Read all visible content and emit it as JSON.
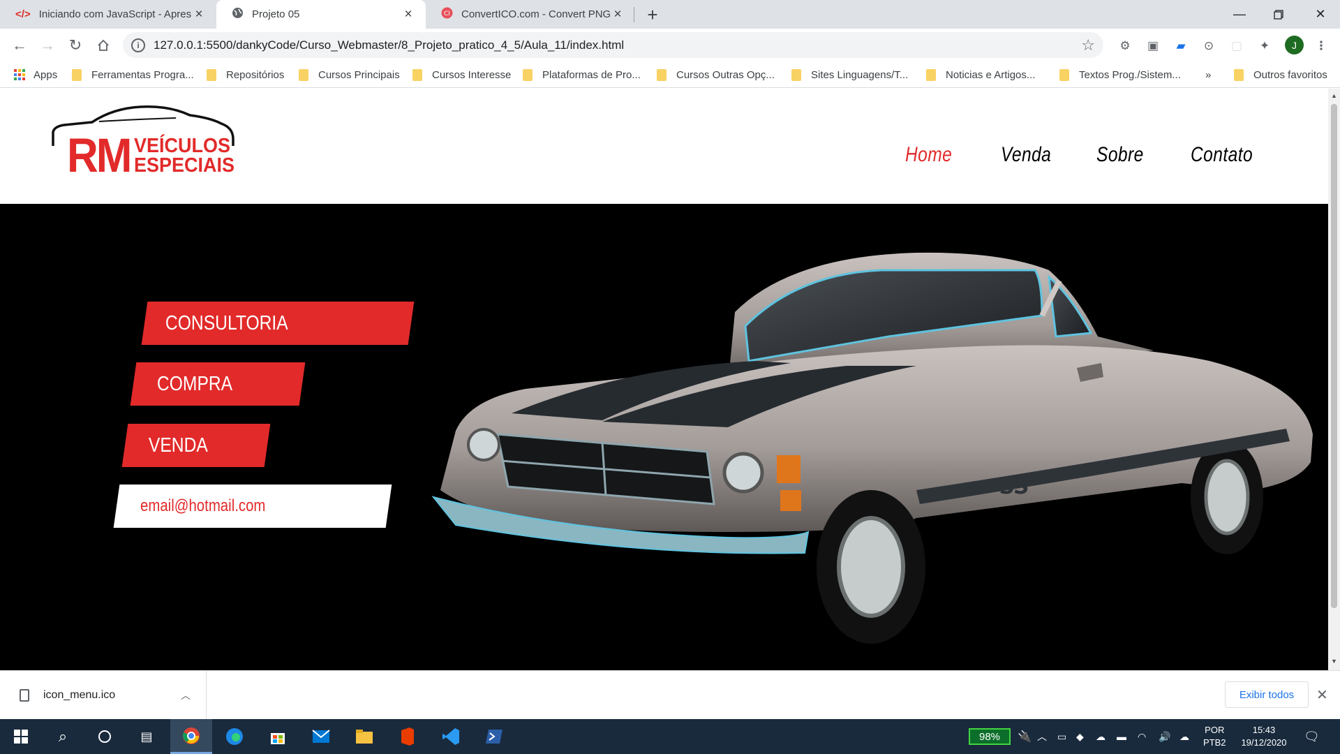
{
  "browser": {
    "tabs": [
      {
        "title": "Iniciando com JavaScript - Apres",
        "icon": "code-icon",
        "active": false
      },
      {
        "title": "Projeto 05",
        "icon": "globe-icon",
        "active": true
      },
      {
        "title": "ConvertICO.com - Convert PNG t",
        "icon": "convertico-icon",
        "active": false
      }
    ],
    "new_tab_label": "+",
    "url": "127.0.0.1:5500/dankyCode/Curso_Webmaster/8_Projeto_pratico_4_5/Aula_11/index.html",
    "profile_initial": "J",
    "bookmarks": [
      {
        "label": "Apps",
        "type": "apps"
      },
      {
        "label": "Ferramentas Progra...",
        "type": "folder"
      },
      {
        "label": "Repositórios",
        "type": "folder"
      },
      {
        "label": "Cursos Principais",
        "type": "folder"
      },
      {
        "label": "Cursos Interesse",
        "type": "folder"
      },
      {
        "label": "Plataformas de Pro...",
        "type": "folder"
      },
      {
        "label": "Cursos Outras Opç...",
        "type": "folder"
      },
      {
        "label": "Sites Linguagens/T...",
        "type": "folder"
      },
      {
        "label": "Noticias e Artigos...",
        "type": "folder"
      },
      {
        "label": "Textos Prog./Sistem...",
        "type": "folder"
      }
    ],
    "bookmarks_overflow": "»",
    "other_bookmarks": "Outros favoritos"
  },
  "site": {
    "logo": {
      "rm": "RM",
      "line1": "VEÍCULOS",
      "line2": "ESPECIAIS"
    },
    "nav": [
      {
        "label": "Home",
        "active": true
      },
      {
        "label": "Venda",
        "active": false
      },
      {
        "label": "Sobre",
        "active": false
      },
      {
        "label": "Contato",
        "active": false
      }
    ],
    "hero": {
      "buttons": [
        "CONSULTORIA",
        "COMPRA",
        "VENDA"
      ],
      "email": "email@hotmail.com"
    },
    "colors": {
      "accent": "#e22a2a",
      "hero_bg": "#000000"
    }
  },
  "downloads": {
    "file": "icon_menu.ico",
    "show_all": "Exibir todos"
  },
  "taskbar": {
    "battery": "98%",
    "lang_top": "POR",
    "lang_bottom": "PTB2",
    "time": "15:43",
    "date": "19/12/2020"
  }
}
